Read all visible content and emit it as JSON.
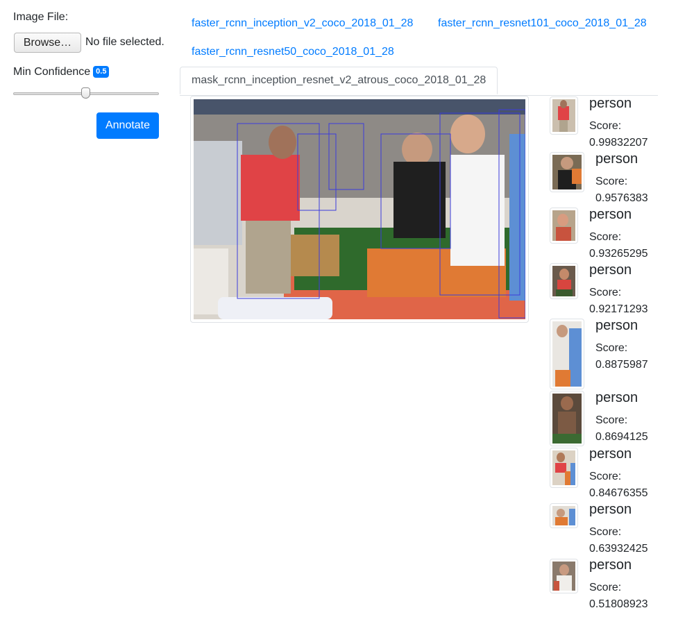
{
  "form": {
    "image_file_label": "Image File:",
    "browse_label": "Browse…",
    "no_file_text": "No file selected.",
    "min_conf_label": "Min Confidence",
    "min_conf_value": "0.5",
    "min_conf_level": 0.5,
    "annotate_label": "Annotate"
  },
  "tabs": [
    {
      "label": "faster_rcnn_inception_v2_coco_2018_01_28",
      "active": false
    },
    {
      "label": "faster_rcnn_resnet101_coco_2018_01_28",
      "active": false
    },
    {
      "label": "faster_rcnn_resnet50_coco_2018_01_28",
      "active": false
    },
    {
      "label": "mask_rcnn_inception_resnet_v2_atrous_coco_2018_01_28",
      "active": true
    }
  ],
  "detections": [
    {
      "label": "person",
      "score_label": "Score:",
      "score": "0.99832207"
    },
    {
      "label": "person",
      "score_label": "Score:",
      "score": "0.9576383"
    },
    {
      "label": "person",
      "score_label": "Score:",
      "score": "0.93265295"
    },
    {
      "label": "person",
      "score_label": "Score:",
      "score": "0.92171293"
    },
    {
      "label": "person",
      "score_label": "Score:",
      "score": "0.8875987"
    },
    {
      "label": "person",
      "score_label": "Score:",
      "score": "0.8694125"
    },
    {
      "label": "person",
      "score_label": "Score:",
      "score": "0.84676355"
    },
    {
      "label": "person",
      "score_label": "Score:",
      "score": "0.63932425"
    },
    {
      "label": "person",
      "score_label": "Score:",
      "score": "0.51808923"
    }
  ],
  "colors": {
    "accent": "#007bff",
    "box": "#3c3cdc"
  }
}
